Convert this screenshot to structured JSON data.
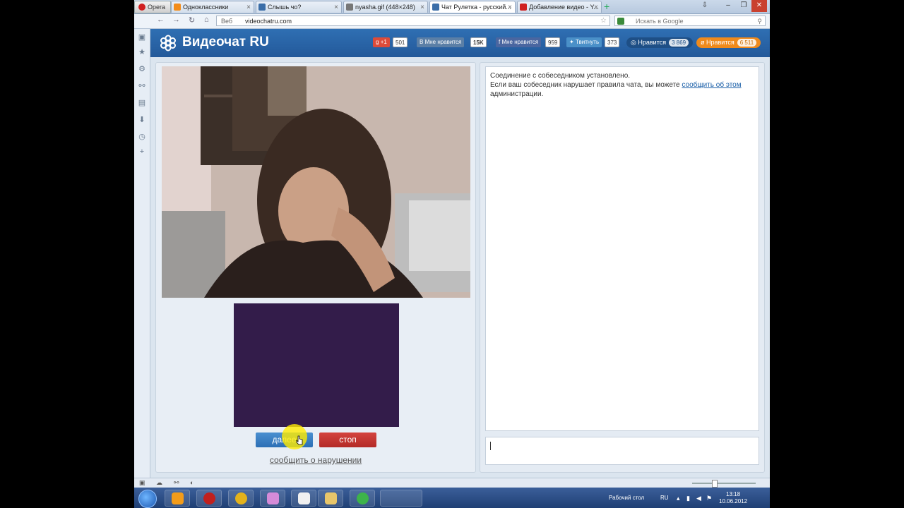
{
  "browser": {
    "menu_label": "Opera",
    "tabs": [
      {
        "label": "Одноклассники",
        "color": "#f28c1a"
      },
      {
        "label": "Слышь чо?",
        "color": "#3b6ea8"
      },
      {
        "label": "nyasha.gif (448×248)",
        "color": "#777777"
      },
      {
        "label": "Чат Рулетка - русский...",
        "color": "#3b6ea8",
        "active": true
      },
      {
        "label": "Добавление видео - Y...",
        "color": "#d02020"
      }
    ],
    "new_tab": "+",
    "address": {
      "prefix": "Веб",
      "url": "videochatru.com"
    },
    "search_placeholder": "Искать в Google"
  },
  "site": {
    "title": "Видеочат RU",
    "social": {
      "gplus_label": "+1",
      "gplus_count": "501",
      "vk_label": "Мне нравится",
      "vk_count": "15K",
      "fb_label": "Мне нравится",
      "fb_count": "959",
      "tw_label": "Твитнуть",
      "tw_count": "373",
      "mm_label": "Нравится",
      "mm_count": "3 869",
      "ok_label": "Нравится",
      "ok_count": "6 511"
    },
    "buttons": {
      "next": "далее",
      "stop": "стоп"
    },
    "report_link": "сообщить о нарушении",
    "chat": {
      "line1": "Соединение с собеседником установлено.",
      "line2_prefix": "Если ваш собеседник нарушает правила чата, вы можете ",
      "line2_link": "сообщить об этом",
      "line3": "администрации."
    }
  },
  "taskbar": {
    "desktop_label": "Рабочий стол",
    "lang": "RU",
    "time": "13:18",
    "date": "10.06.2012"
  },
  "colors": {
    "header": "#2b66a8",
    "next": "#3b7fc4",
    "stop": "#c2342f",
    "self_cam": "#331c4a"
  }
}
